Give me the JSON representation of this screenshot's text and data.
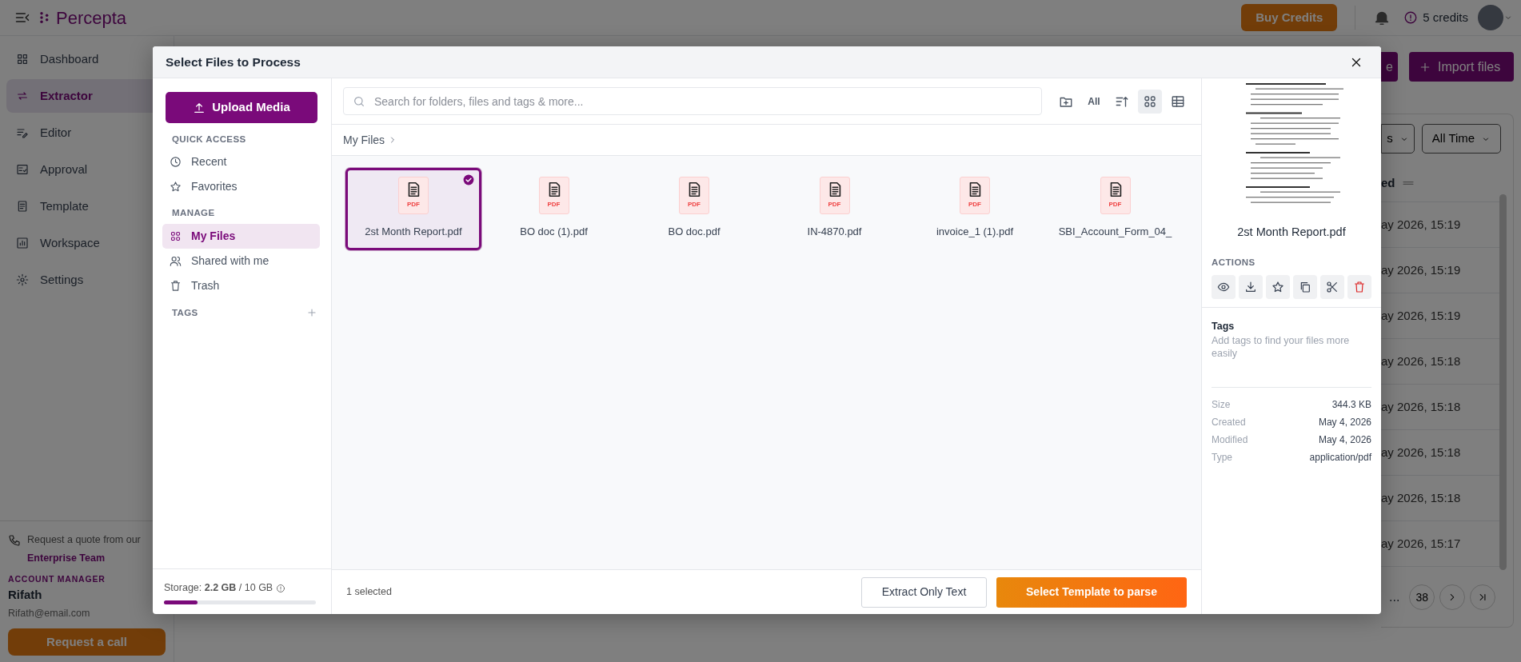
{
  "topbar": {
    "logo": "Percepta",
    "buy_credits": "Buy Credits",
    "credits": "5 credits"
  },
  "sidebar": {
    "items": [
      {
        "label": "Dashboard",
        "selected": false
      },
      {
        "label": "Extractor",
        "selected": true
      },
      {
        "label": "Editor",
        "selected": false
      },
      {
        "label": "Approval",
        "selected": false
      },
      {
        "label": "Template",
        "selected": false
      },
      {
        "label": "Workspace",
        "selected": false
      },
      {
        "label": "Settings",
        "selected": false
      }
    ],
    "contact": {
      "text": "Request a quote from our",
      "link": "Enterprise Team"
    },
    "account_manager": {
      "heading": "ACCOUNT MANAGER",
      "name": "Rifath",
      "email": "Rifath@email.com"
    },
    "request_call": "Request a call"
  },
  "background": {
    "cut_button": "e",
    "import_button": "Import files",
    "filters": [
      "s",
      "All Time"
    ],
    "column_header": "ed",
    "rows": [
      "ay 2026, 15:19",
      "ay 2026, 15:19",
      "ay 2026, 15:19",
      "ay 2026, 15:18",
      "ay 2026, 15:18",
      "ay 2026, 15:18",
      "ay 2026, 15:18",
      "ay 2026, 15:17"
    ],
    "pagination": {
      "ellipsis": "...",
      "page": "38"
    }
  },
  "dialog": {
    "title": "Select Files to Process",
    "upload_button": "Upload Media",
    "sections": [
      {
        "heading": "QUICK ACCESS",
        "items": [
          {
            "label": "Recent",
            "selected": false
          },
          {
            "label": "Favorites",
            "selected": false
          }
        ]
      },
      {
        "heading": "MANAGE",
        "items": [
          {
            "label": "My Files",
            "selected": true
          },
          {
            "label": "Shared with me",
            "selected": false
          },
          {
            "label": "Trash",
            "selected": false
          }
        ]
      }
    ],
    "tags_heading": "TAGS",
    "storage": {
      "text": "Storage: **2.2 GB** / 10 GB",
      "level": 0.22
    },
    "search": {
      "placeholder": "Search for folders, files and tags & more..."
    },
    "filter_all": "All",
    "view_modes": [
      {
        "kind": "grid",
        "selected": true
      },
      {
        "kind": "table",
        "selected": false
      }
    ],
    "breadcrumb": "My Files",
    "files": [
      {
        "name": "2st Month Report.pdf",
        "badge": "PDF",
        "selected": true
      },
      {
        "name": "BO doc (1).pdf",
        "badge": "PDF",
        "selected": false
      },
      {
        "name": "BO doc.pdf",
        "badge": "PDF",
        "selected": false
      },
      {
        "name": "IN-4870.pdf",
        "badge": "PDF",
        "selected": false
      },
      {
        "name": "invoice_1 (1).pdf",
        "badge": "PDF",
        "selected": false
      },
      {
        "name": "SBI_Account_Form_04_",
        "badge": "PDF",
        "selected": false
      }
    ],
    "selected_count": "1 selected",
    "secondary_button": "Extract Only Text",
    "primary_button": "Select Template to parse",
    "details": {
      "file_name": "2st Month Report.pdf",
      "actions_heading": "ACTIONS",
      "tags_heading": "Tags",
      "tags_hint": "Add tags to find your files more easily",
      "properties": [
        {
          "label": "Size",
          "value": "344.3 KB"
        },
        {
          "label": "Created",
          "value": "May 4, 2026"
        },
        {
          "label": "Modified",
          "value": "May 4, 2026"
        },
        {
          "label": "Type",
          "value": "application/pdf"
        }
      ]
    }
  }
}
